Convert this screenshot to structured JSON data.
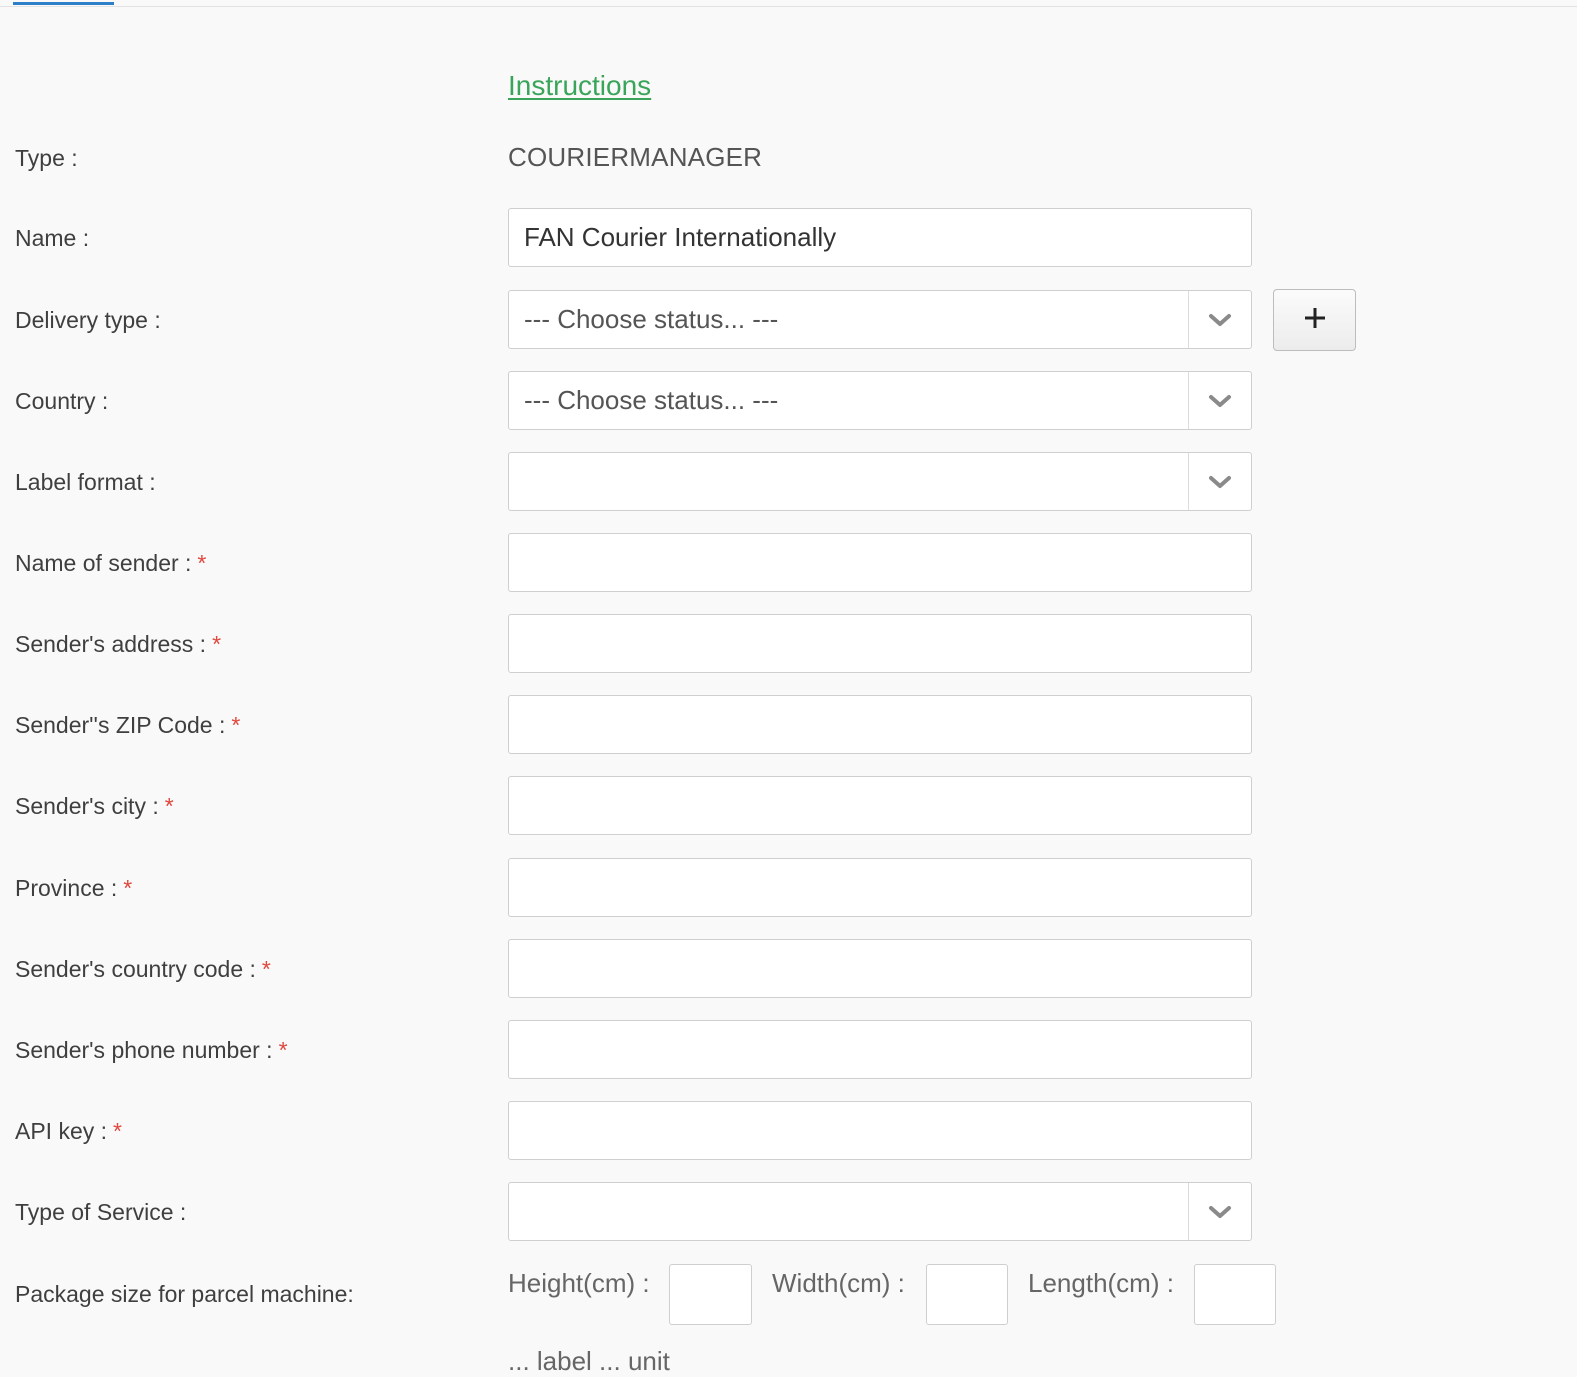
{
  "instructions_link": "Instructions",
  "labels": {
    "type": "Type :",
    "name": "Name :",
    "delivery_type": "Delivery type :",
    "country": "Country :",
    "label_format": "Label format :",
    "name_of_sender": "Name of sender :",
    "sender_address": "Sender's address :",
    "sender_zip": "Sender''s ZIP Code :",
    "sender_city": "Sender's city :",
    "province": "Province :",
    "sender_country_code": "Sender's country code :",
    "sender_phone": "Sender's phone number :",
    "api_key": "API key :",
    "type_of_service": "Type of Service :",
    "package_size": "Package size for parcel machine:"
  },
  "required_marker": "*",
  "values": {
    "type": "COURIERMANAGER",
    "name": "FAN Courier Internationally",
    "delivery_type": "--- Choose status... ---",
    "country": "--- Choose status... ---",
    "label_format": "",
    "name_of_sender": "",
    "sender_address": "",
    "sender_zip": "",
    "sender_city": "",
    "province": "",
    "sender_country_code": "",
    "sender_phone": "",
    "api_key": "",
    "type_of_service": "",
    "height": "",
    "width": "",
    "length": ""
  },
  "dimensions": {
    "height_label": "Height(cm) :",
    "width_label": "Width(cm) :",
    "length_label": "Length(cm) :"
  },
  "add_button_icon": "plus-icon",
  "dropdown_icon": "chevron-down-icon",
  "colors": {
    "link": "#3aa55a",
    "required": "#e0483e",
    "active_tab": "#2c7fc8"
  },
  "cutoff_text": "... label ... unit"
}
